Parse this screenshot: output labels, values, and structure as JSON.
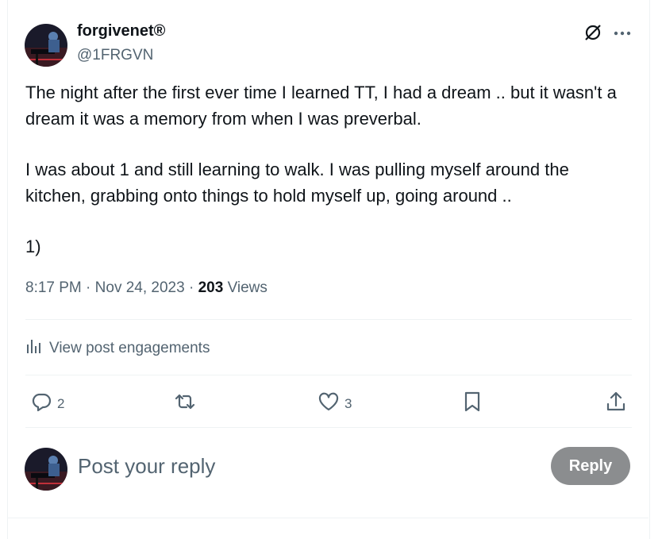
{
  "post": {
    "author_name": "forgivenet®",
    "author_handle": "@1FRGVN",
    "paragraphs": [
      "The night after the first ever time I learned TT, I had a dream .. but it wasn't a dream it was a memory from when I was preverbal.",
      "I was about 1 and still learning to walk. I was pulling myself around the kitchen, grabbing onto things to hold myself up, going around ..",
      "1)"
    ],
    "time": "8:17 PM",
    "date": "Nov 24, 2023",
    "separator": "·",
    "views_count": "203",
    "views_label": "Views"
  },
  "engagements_link": "View post engagements",
  "actions": {
    "reply_count": "2",
    "like_count": "3"
  },
  "reply_box": {
    "placeholder": "Post your reply",
    "button_label": "Reply"
  },
  "icons": [
    "grok-icon",
    "more-icon",
    "analytics-icon",
    "reply-icon",
    "repost-icon",
    "like-icon",
    "bookmark-icon",
    "share-icon"
  ],
  "colors": {
    "text": "#0f1419",
    "secondary": "#536471",
    "divider": "#eff3f4",
    "reply_button": "#8b8d8f"
  }
}
